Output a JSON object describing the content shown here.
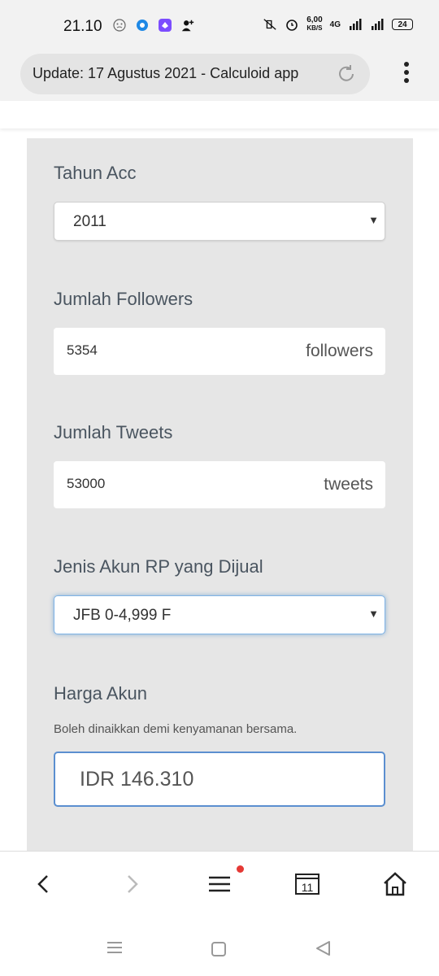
{
  "status_bar": {
    "time": "21.10",
    "net_speed_value": "6,00",
    "net_speed_unit": "KB/S",
    "network_type": "4G",
    "battery": "24"
  },
  "browser": {
    "url_title": "Update: 17 Agustus 2021 - Calculoid app"
  },
  "form": {
    "tahun_acc": {
      "label": "Tahun Acc",
      "value": "2011"
    },
    "followers": {
      "label": "Jumlah Followers",
      "value": "5354",
      "unit": "followers"
    },
    "tweets": {
      "label": "Jumlah Tweets",
      "value": "53000",
      "unit": "tweets"
    },
    "jenis_akun": {
      "label": "Jenis Akun RP yang Dijual",
      "value": "JFB 0-4,999 F"
    },
    "harga": {
      "label": "Harga Akun",
      "hint": "Boleh dinaikkan demi kenyamanan bersama.",
      "value": "IDR 146.310"
    }
  },
  "bottom_nav": {
    "tab_count": "11"
  },
  "colors": {
    "panel_bg": "#e6e6e6",
    "label_text": "#4a5560",
    "focus_blue": "#5b8fd0",
    "badge_red": "#e53935"
  }
}
